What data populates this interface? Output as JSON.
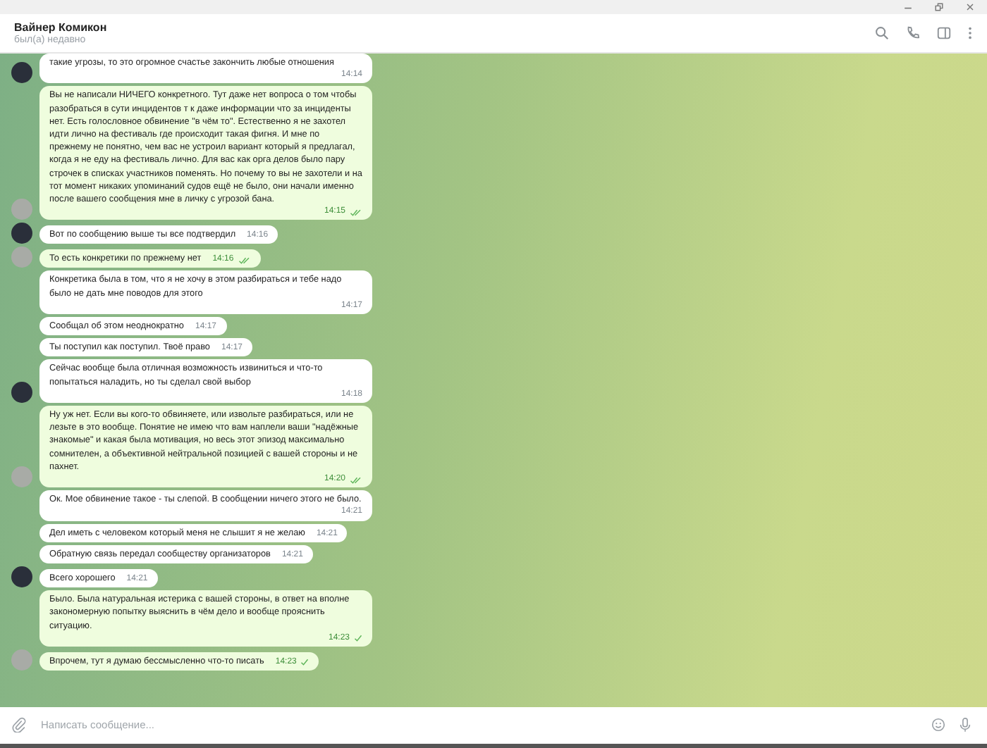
{
  "header": {
    "title": "Вайнер Комикон",
    "status": "был(а) недавно"
  },
  "messages": [
    {
      "kind": "incoming",
      "text": "такие угрозы, то это огромное счастье закончить любые отношения",
      "time": "14:14",
      "avatar": true
    },
    {
      "kind": "outgoing",
      "text": "Вы не написали НИЧЕГО конкретного. Тут даже нет вопроса о том чтобы разобраться в сути инцидентов т к даже информации что за инциденты нет. Есть голословное обвинение \"в чём то\". Естественно я не захотел идти лично на фестиваль где происходит такая фигня. И мне по прежнему не понятно, чем вас не устроил вариант который я предлагал, когда я не еду на фестиваль лично. Для вас как орга делов было пару строчек в списках участников поменять. Но почему то вы не захотели и на тот момент никаких упоминаний судов ещё не было, они начали именно после вашего сообщения мне в личку с угрозой бана.",
      "time": "14:15",
      "read": true,
      "avatar": true
    },
    {
      "kind": "incoming",
      "text": "Вот по сообщению выше ты все подтвердил",
      "time": "14:16",
      "avatar": true
    },
    {
      "kind": "outgoing",
      "text": "То есть конкретики по прежнему нет",
      "time": "14:16",
      "read": true,
      "avatar": true
    },
    {
      "kind": "incoming",
      "text": "Конкретика была в том, что я не хочу в этом разбираться и тебе надо было не дать мне поводов для этого",
      "time": "14:17",
      "avatar": false
    },
    {
      "kind": "incoming",
      "text": "Сообщал об этом неоднократно",
      "time": "14:17",
      "avatar": false
    },
    {
      "kind": "incoming",
      "text": "Ты поступил как поступил. Твоё право",
      "time": "14:17",
      "avatar": false
    },
    {
      "kind": "incoming",
      "text": "Сейчас вообще была отличная возможность извиниться и что-то попытаться наладить, но ты сделал свой выбор",
      "time": "14:18",
      "avatar": true
    },
    {
      "kind": "outgoing",
      "text": "Ну уж нет. Если вы кого-то обвиняете, или извольте разбираться, или не лезьте в это вообще. Понятие не имею что вам наплели ваши \"надёжные знакомые\" и какая была мотивация, но весь этот эпизод максимально сомнителен, а объективной нейтральной позицией с вашей стороны и не пахнет.",
      "time": "14:20",
      "read": true,
      "avatar": true
    },
    {
      "kind": "incoming",
      "text": "Ок. Мое обвинение такое - ты слепой. В сообщении ничего этого не было.",
      "time": "14:21",
      "avatar": false
    },
    {
      "kind": "incoming",
      "text": "Дел иметь с человеком который меня не слышит я не желаю",
      "time": "14:21",
      "avatar": false
    },
    {
      "kind": "incoming",
      "text": "Обратную связь передал сообществу организаторов",
      "time": "14:21",
      "avatar": false
    },
    {
      "kind": "incoming",
      "text": "Всего хорошего",
      "time": "14:21",
      "avatar": true
    },
    {
      "kind": "outgoing",
      "text": "Было. Была натуральная истерика с вашей стороны, в ответ на вполне закономерную попытку выяснить в чём дело и вообще прояснить ситуацию.",
      "time": "14:23",
      "read": false,
      "avatar": false
    },
    {
      "kind": "outgoing",
      "text": "Впрочем, тут я думаю бессмысленно что-то писать",
      "time": "14:23",
      "read": false,
      "avatar": true
    }
  ],
  "composer": {
    "placeholder": "Написать сообщение..."
  }
}
